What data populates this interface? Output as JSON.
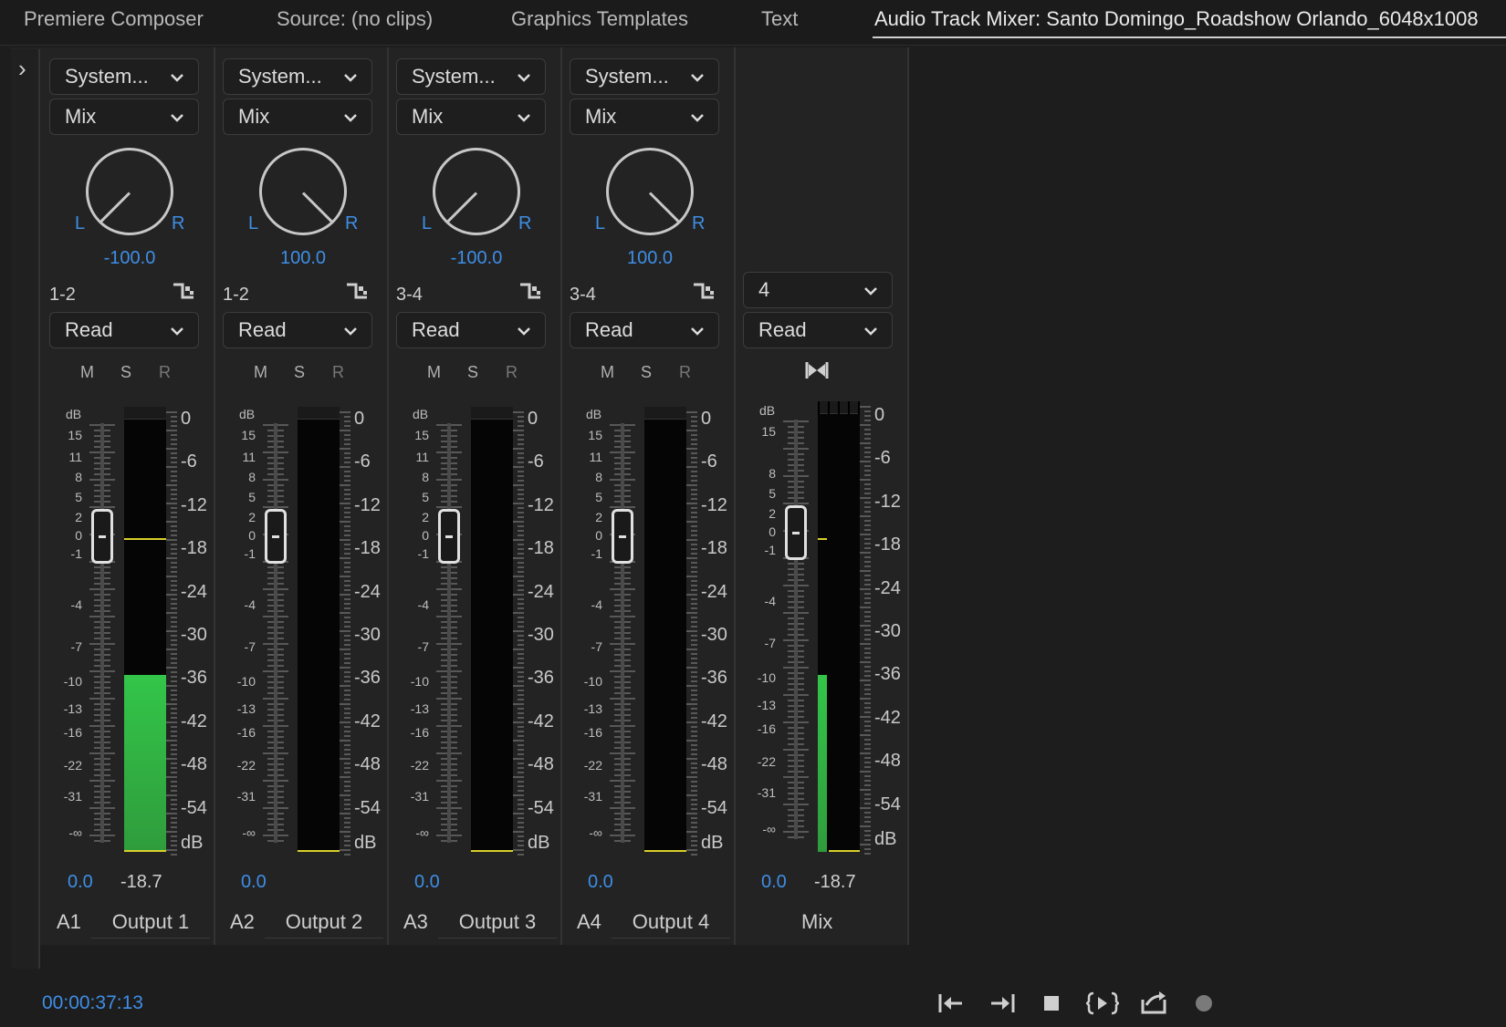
{
  "tabs": [
    {
      "label": "Premiere Composer"
    },
    {
      "label": "Source: (no clips)"
    },
    {
      "label": "Graphics Templates"
    },
    {
      "label": "Text"
    },
    {
      "label": "Audio Track Mixer: Santo Domingo_Roadshow Orlando_6048x1008"
    }
  ],
  "strips": [
    {
      "input": "System...",
      "effect": "Mix",
      "pan_value": "-100.0",
      "pan": -100,
      "route": "1-2",
      "automation": "Read",
      "mute": "M",
      "solo": "S",
      "record": "R",
      "volume": "0.0",
      "peak": "-18.7",
      "track": "A1",
      "output": "Output 1",
      "meter_level_db": -35.5,
      "peak_hold_db": -16.5
    },
    {
      "input": "System...",
      "effect": "Mix",
      "pan_value": "100.0",
      "pan": 100,
      "route": "1-2",
      "automation": "Read",
      "mute": "M",
      "solo": "S",
      "record": "R",
      "volume": "0.0",
      "peak": "",
      "track": "A2",
      "output": "Output 2",
      "meter_level_db": null,
      "peak_hold_db": null
    },
    {
      "input": "System...",
      "effect": "Mix",
      "pan_value": "-100.0",
      "pan": -100,
      "route": "3-4",
      "automation": "Read",
      "mute": "M",
      "solo": "S",
      "record": "R",
      "volume": "0.0",
      "peak": "",
      "track": "A3",
      "output": "Output 3",
      "meter_level_db": null,
      "peak_hold_db": null
    },
    {
      "input": "System...",
      "effect": "Mix",
      "pan_value": "100.0",
      "pan": 100,
      "route": "3-4",
      "automation": "Read",
      "mute": "M",
      "solo": "S",
      "record": "R",
      "volume": "0.0",
      "peak": "",
      "track": "A4",
      "output": "Output 4",
      "meter_level_db": null,
      "peak_hold_db": null
    }
  ],
  "master": {
    "channels": "4",
    "automation": "Read",
    "volume": "0.0",
    "peak": "-18.7",
    "name": "Mix",
    "meter_level_db": -35.5,
    "peak_hold_db": -16.5
  },
  "fader_scale": {
    "unit": "dB",
    "labels": [
      "15",
      "11",
      "8",
      "5",
      "2",
      "0",
      "-1",
      "-4",
      "-7",
      "-10",
      "-13",
      "-16",
      "-22",
      "-31",
      "-∞"
    ]
  },
  "master_fader_scale": {
    "unit": "dB",
    "labels": [
      "15",
      "8",
      "5",
      "2",
      "0",
      "-1",
      "-4",
      "-7",
      "-10",
      "-13",
      "-16",
      "-22",
      "-31",
      "-∞"
    ]
  },
  "meter_scale": {
    "labels": [
      "0",
      "-6",
      "-12",
      "-18",
      "-24",
      "-30",
      "-36",
      "-42",
      "-48",
      "-54",
      "dB"
    ]
  },
  "pan_labels": {
    "left": "L",
    "right": "R"
  },
  "timecode": "00:00:37:13",
  "transport": [
    "go-to-in-icon",
    "go-to-out-icon",
    "stop-icon",
    "play-in-to-out-icon",
    "loop-icon",
    "record-icon"
  ],
  "colors": {
    "accent": "#3e8ee6",
    "meter_green": "#33c549",
    "peak_yellow": "#d9d02a"
  }
}
